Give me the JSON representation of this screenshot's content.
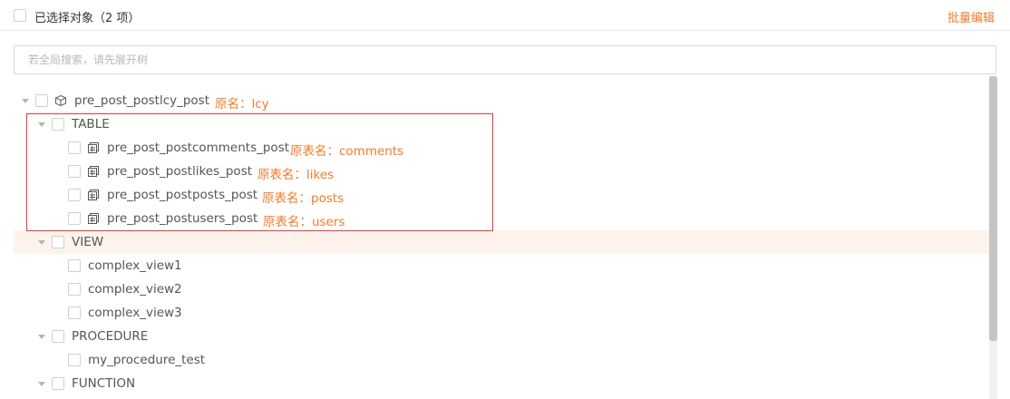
{
  "header": {
    "title": "已选择对象（2 项）",
    "batch_edit": "批量编辑"
  },
  "search": {
    "placeholder": "若全局搜索，请先展开树"
  },
  "tree": {
    "root": {
      "label": "pre_post_postlcy_post",
      "orig": "原名：lcy"
    },
    "table_group": {
      "label": "TABLE",
      "items": [
        {
          "label": "pre_post_postcomments_post",
          "orig": "原表名：comments"
        },
        {
          "label": "pre_post_postlikes_post",
          "orig": "原表名：likes"
        },
        {
          "label": "pre_post_postposts_post",
          "orig": "原表名：posts"
        },
        {
          "label": "pre_post_postusers_post",
          "orig": "原表名：users"
        }
      ]
    },
    "view_group": {
      "label": "VIEW",
      "items": [
        "complex_view1",
        "complex_view2",
        "complex_view3"
      ]
    },
    "procedure_group": {
      "label": "PROCEDURE",
      "items": [
        "my_procedure_test"
      ]
    },
    "function_group": {
      "label": "FUNCTION"
    }
  },
  "colors": {
    "accent": "#f07b28",
    "highlight_row": "#fdf3ec",
    "selection_box": "#e0393e"
  },
  "icons": {
    "root": "cube-icon",
    "table": "table-copy-icon",
    "collapse": "caret-down-icon"
  }
}
